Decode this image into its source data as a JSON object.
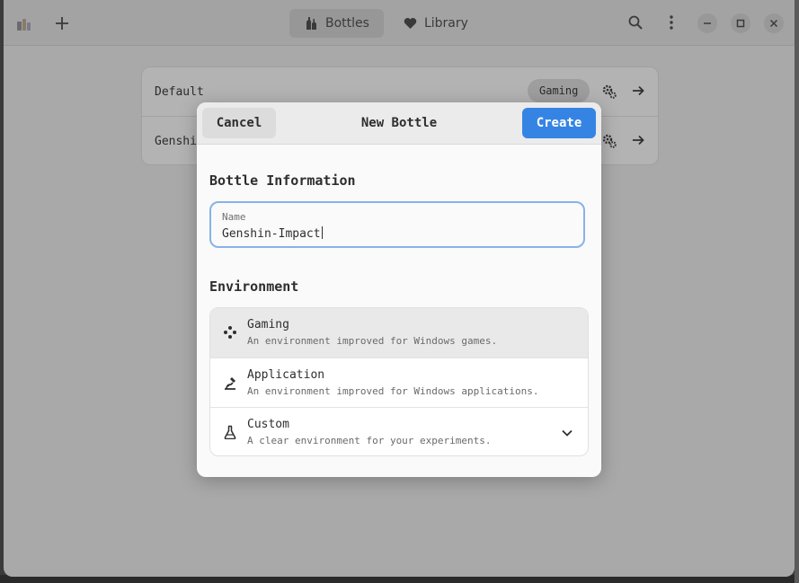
{
  "headerbar": {
    "tabs": [
      {
        "label": "Bottles",
        "icon": "bottles-icon",
        "active": true
      },
      {
        "label": "Library",
        "icon": "heart-icon",
        "active": false
      }
    ]
  },
  "bottles": [
    {
      "name": "Default",
      "badge": "Gaming"
    },
    {
      "name": "Genshi",
      "badge": ""
    }
  ],
  "dialog": {
    "title": "New Bottle",
    "cancel_label": "Cancel",
    "create_label": "Create",
    "bottle_info_title": "Bottle Information",
    "name_field": {
      "label": "Name",
      "value": "Genshin-Impact"
    },
    "environment_title": "Environment",
    "environments": [
      {
        "title": "Gaming",
        "subtitle": "An environment improved for Windows games.",
        "icon": "gamepad-icon",
        "selected": true
      },
      {
        "title": "Application",
        "subtitle": "An environment improved for Windows applications.",
        "icon": "application-icon",
        "selected": false
      },
      {
        "title": "Custom",
        "subtitle": "A clear environment for your experiments.",
        "icon": "flask-icon",
        "selected": false
      }
    ]
  },
  "colors": {
    "accent": "#3584e4",
    "focus_ring": "#87b2e9",
    "dimmed_window": "#a9a9a9"
  }
}
